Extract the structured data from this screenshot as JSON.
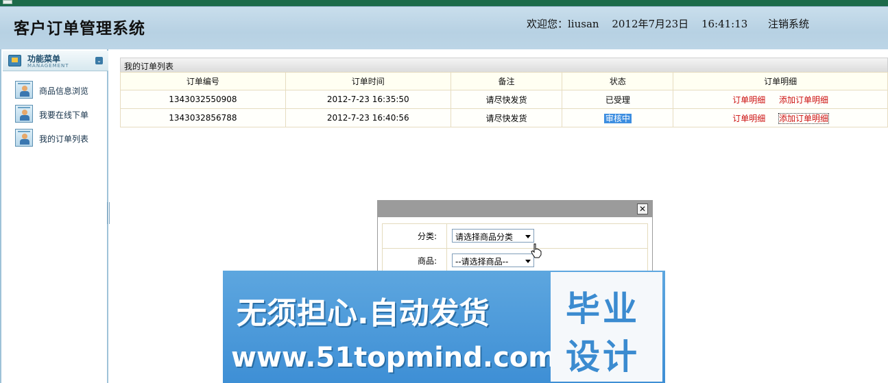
{
  "app_title": "客户订单管理系统",
  "header": {
    "welcome": "欢迎您：liusan",
    "date": "2012年7月23日",
    "time": "16:41:13",
    "logout": "注销系统"
  },
  "menu": {
    "title": "功能菜单",
    "subtitle": "MANAGEMENT",
    "items": [
      {
        "label": "商品信息浏览"
      },
      {
        "label": "我要在线下单"
      },
      {
        "label": "我的订单列表"
      }
    ]
  },
  "orders": {
    "title": "我的订单列表",
    "columns": [
      "订单编号",
      "订单时间",
      "备注",
      "状态",
      "订单明细"
    ],
    "rows": [
      {
        "id": "1343032550908",
        "time": "2012-7-23 16:35:50",
        "note": "请尽快发货",
        "status": "已受理",
        "detail": "订单明细",
        "add": "添加订单明细"
      },
      {
        "id": "1343032856788",
        "time": "2012-7-23 16:40:56",
        "note": "请尽快发货",
        "status": "审核中",
        "detail": "订单明细",
        "add": "添加订单明细"
      }
    ]
  },
  "dialog": {
    "close": "✕",
    "category_label": "分类:",
    "category_value": "请选择商品分类",
    "product_label": "商品:",
    "product_value": "--请选择商品--"
  },
  "watermark": {
    "line1": "无须担心.自动发货",
    "line2": "www.51topmind.com",
    "box1": "毕业",
    "box2": "设计"
  },
  "colors": {
    "header_bg": "#bcd5e6",
    "link_red": "#cc1010",
    "status_highlight": "#3d8ee0",
    "watermark_blue": "#4a98da"
  }
}
